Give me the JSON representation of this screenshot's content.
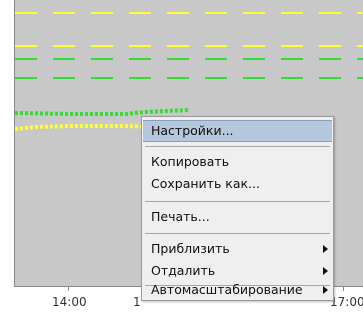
{
  "chart_area": {
    "background": "#c8c8c8",
    "line_colors": [
      "#ffff33",
      "#33dd33"
    ]
  },
  "x_axis": {
    "tick_labels": [
      "14:00",
      "1",
      "17:00"
    ]
  },
  "context_menu": {
    "items": [
      {
        "label": "Настройки...",
        "selected": true,
        "submenu": false
      },
      {
        "label": "Копировать",
        "selected": false,
        "submenu": false
      },
      {
        "label": "Сохранить как...",
        "selected": false,
        "submenu": false
      },
      {
        "label": "Печать...",
        "selected": false,
        "submenu": false
      },
      {
        "label": "Приблизить",
        "selected": false,
        "submenu": true,
        "submenu_icon": "chevron-right-icon"
      },
      {
        "label": "Отдалить",
        "selected": false,
        "submenu": true,
        "submenu_icon": "chevron-right-icon"
      },
      {
        "label": "Автомасштабирование",
        "selected": false,
        "submenu": true,
        "submenu_icon": "chevron-right-icon"
      }
    ]
  }
}
